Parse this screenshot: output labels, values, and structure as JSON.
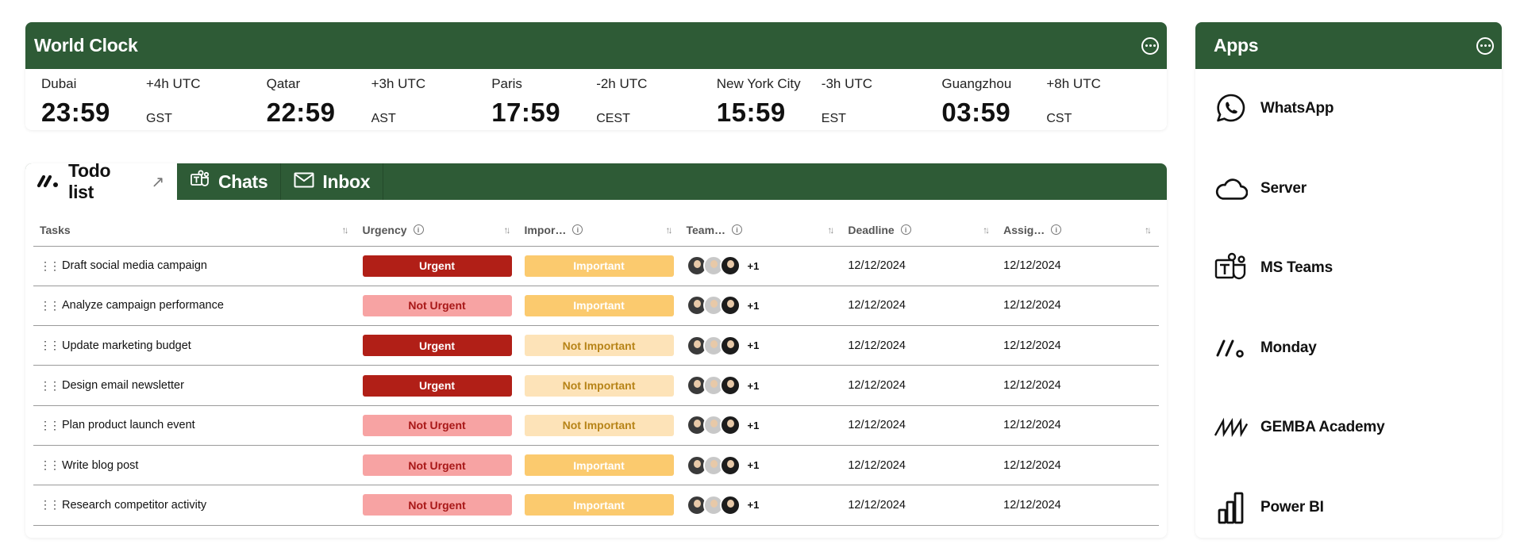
{
  "world_clock": {
    "title": "World Clock",
    "cities": [
      {
        "name": "Dubai",
        "time": "23:59",
        "offset": "+4h UTC",
        "zone": "GST"
      },
      {
        "name": "Qatar",
        "time": "22:59",
        "offset": "+3h UTC",
        "zone": "AST"
      },
      {
        "name": "Paris",
        "time": "17:59",
        "offset": "-2h UTC",
        "zone": "CEST"
      },
      {
        "name": "New York City",
        "time": "15:59",
        "offset": "-3h UTC",
        "zone": "EST"
      },
      {
        "name": "Guangzhou",
        "time": "03:59",
        "offset": "+8h UTC",
        "zone": "CST"
      }
    ]
  },
  "tabs": {
    "todo": "Todo list",
    "chats": "Chats",
    "inbox": "Inbox"
  },
  "table": {
    "columns": {
      "tasks": "Tasks",
      "urgency": "Urgency",
      "importance": "Impor…",
      "team": "Team…",
      "deadline": "Deadline",
      "assigned": "Assig…"
    },
    "rows": [
      {
        "task": "Draft social media campaign",
        "urgency": "Urgent",
        "importance": "Important",
        "more": "+1",
        "deadline": "12/12/2024",
        "assigned": "12/12/2024"
      },
      {
        "task": "Analyze campaign performance",
        "urgency": "Not Urgent",
        "importance": "Important",
        "more": "+1",
        "deadline": "12/12/2024",
        "assigned": "12/12/2024"
      },
      {
        "task": "Update marketing budget",
        "urgency": "Urgent",
        "importance": "Not Important",
        "more": "+1",
        "deadline": "12/12/2024",
        "assigned": "12/12/2024"
      },
      {
        "task": "Design email newsletter",
        "urgency": "Urgent",
        "importance": "Not Important",
        "more": "+1",
        "deadline": "12/12/2024",
        "assigned": "12/12/2024"
      },
      {
        "task": "Plan product launch event",
        "urgency": "Not Urgent",
        "importance": "Not Important",
        "more": "+1",
        "deadline": "12/12/2024",
        "assigned": "12/12/2024"
      },
      {
        "task": "Write blog post",
        "urgency": "Not Urgent",
        "importance": "Important",
        "more": "+1",
        "deadline": "12/12/2024",
        "assigned": "12/12/2024"
      },
      {
        "task": "Research competitor activity",
        "urgency": "Not Urgent",
        "importance": "Important",
        "more": "+1",
        "deadline": "12/12/2024",
        "assigned": "12/12/2024"
      }
    ]
  },
  "apps": {
    "title": "Apps",
    "items": [
      {
        "label": "WhatsApp",
        "icon": "whatsapp-icon"
      },
      {
        "label": "Server",
        "icon": "cloud-icon"
      },
      {
        "label": "MS Teams",
        "icon": "ms-teams-icon"
      },
      {
        "label": "Monday",
        "icon": "monday-icon"
      },
      {
        "label": "GEMBA Academy",
        "icon": "gemba-icon"
      },
      {
        "label": "Power BI",
        "icon": "power-bi-icon"
      }
    ]
  },
  "colors": {
    "header_green": "#2e5b36",
    "urgent_bg": "#b11f17",
    "urgent_fg": "#ffffff",
    "not_urgent_bg": "#f7a3a3",
    "not_urgent_fg": "#a81818",
    "important_bg": "#fbca6e",
    "important_fg": "#ffffff",
    "not_important_bg": "#fde3b8",
    "not_important_fg": "#b78418"
  }
}
